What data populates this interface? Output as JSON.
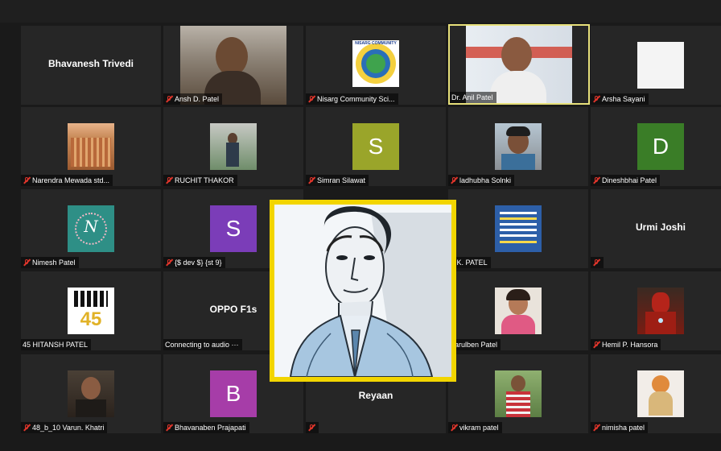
{
  "meeting": {
    "window_title": "",
    "participants": [
      {
        "name": "Bhavanesh Trivedi",
        "type": "name_only",
        "muted": false,
        "show_namebar": false
      },
      {
        "name": "Ansh D. Patel",
        "type": "video",
        "muted": true
      },
      {
        "name": "Nisarg Community Sci...",
        "type": "logo",
        "muted": true
      },
      {
        "name": "Dr. Anil Patel",
        "type": "video",
        "muted": false,
        "active_speaker": true
      },
      {
        "name": "Arsha Sayani",
        "type": "blank_video",
        "muted": true
      },
      {
        "name": "Narendra Mewada std...",
        "type": "video",
        "muted": true
      },
      {
        "name": "RUCHIT THAKOR",
        "type": "video",
        "muted": true
      },
      {
        "name": "Simran Silawat",
        "type": "avatar",
        "initial": "S",
        "color": "#9aa52a",
        "muted": true
      },
      {
        "name": "ladhubha Solnki",
        "type": "video",
        "muted": true
      },
      {
        "name": "Dineshbhai Patel",
        "type": "avatar",
        "initial": "D",
        "color": "#3a7d27",
        "muted": true
      },
      {
        "name": "Nimesh Patel",
        "type": "monogram",
        "muted": true
      },
      {
        "name": "{$ dev $} {st 9}",
        "type": "avatar",
        "initial": "S",
        "color": "#7b3db8",
        "muted": true
      },
      {
        "name": "K.K. PATEL",
        "type": "poster",
        "muted": false
      },
      {
        "name": "Urmi Joshi",
        "type": "name_only",
        "muted": true
      },
      {
        "name": "45 HITANSH PATEL",
        "type": "image",
        "muted": false
      },
      {
        "name": "OPPO F1s",
        "type": "name_only",
        "muted": false,
        "status": "Connecting to audio ···"
      },
      {
        "name": "Parulben Patel",
        "type": "video",
        "muted": false
      },
      {
        "name": "Hemil P. Hansora",
        "type": "image",
        "muted": true
      },
      {
        "name": "48_b_10 Varun. Khatri",
        "type": "video",
        "muted": true
      },
      {
        "name": "Bhavanaben Prajapati",
        "type": "avatar",
        "initial": "B",
        "color": "#a63da8",
        "muted": true
      },
      {
        "name": "Reyaan",
        "type": "name_only",
        "muted": true
      },
      {
        "name": "vikram patel",
        "type": "video",
        "muted": true
      },
      {
        "name": "nimisha patel",
        "type": "image",
        "muted": true
      }
    ]
  },
  "labels": {
    "bhavanesh": "Bhavanesh Trivedi",
    "ansh": "Ansh D. Patel",
    "nisarg": "Nisarg Community Sci...",
    "anil": "Dr. Anil Patel",
    "arsha": "Arsha Sayani",
    "narendra": "Narendra Mewada std...",
    "ruchit": "RUCHIT THAKOR",
    "simran": "Simran Silawat",
    "simran_initial": "S",
    "ladhubha": "ladhubha Solnki",
    "dinesh": "Dineshbhai Patel",
    "dinesh_initial": "D",
    "nimesh": "Nimesh Patel",
    "dev": "{$ dev $} {st 9}",
    "dev_initial": "S",
    "kk": "K.K. PATEL",
    "urmi": "Urmi Joshi",
    "hitansh": "45 HITANSH PATEL",
    "oppo": "OPPO F1s",
    "oppo_status": "Connecting to audio ···",
    "parul": "Parulben Patel",
    "hemil": "Hemil P. Hansora",
    "varun": "48_b_10 Varun. Khatri",
    "bhavana": "Bhavanaben Prajapati",
    "bhavana_initial": "B",
    "reyaan": "Reyaan",
    "vikram": "vikram patel",
    "nimisha": "nimisha patel",
    "nisarg_logo_text": "NISARG COMMUNITY",
    "monogram_letter": "N",
    "hitansh_image_text": "45"
  },
  "colors": {
    "active_speaker_border": "#e7e07a",
    "popup_border": "#f2d500",
    "mute_icon": "#e0352b",
    "tile_bg": "#262626",
    "background": "#1a1a1a"
  }
}
